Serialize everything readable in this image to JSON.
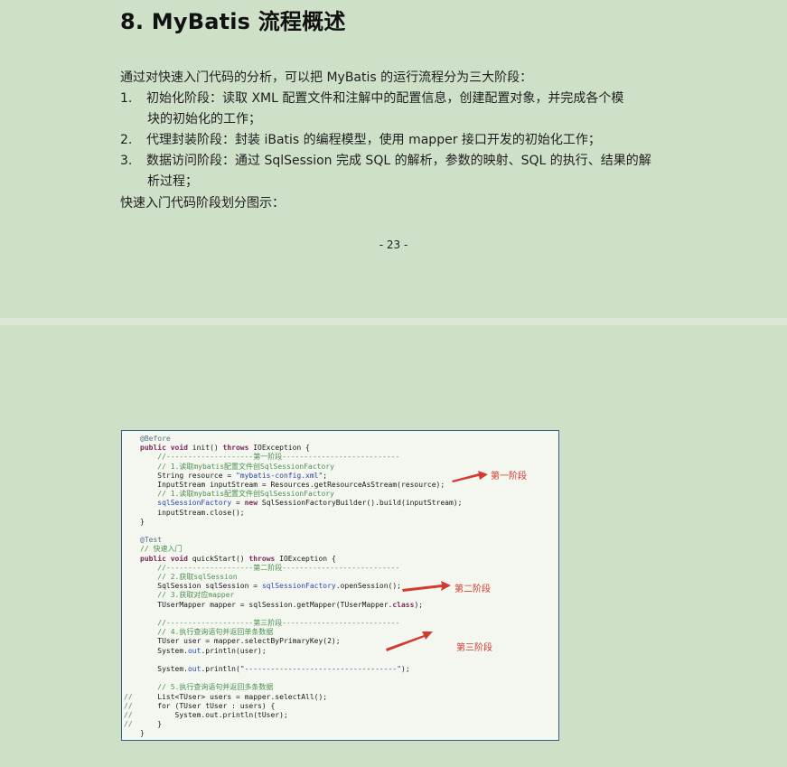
{
  "heading": "8. MyBatis 流程概述",
  "intro": "通过对快速入门代码的分析，可以把 MyBatis 的运行流程分为三大阶段：",
  "stages": [
    {
      "num": "1.",
      "text": "初始化阶段：读取 XML 配置文件和注解中的配置信息，创建配置对象，并完成各个模",
      "cont": "块的初始化的工作；"
    },
    {
      "num": "2.",
      "text": "代理封装阶段：封装 iBatis 的编程模型，使用 mapper 接口开发的初始化工作；",
      "cont": ""
    },
    {
      "num": "3.",
      "text": "数据访问阶段：通过 SqlSession 完成 SQL 的解析，参数的映射、SQL 的执行、结果的解",
      "cont": "析过程；"
    }
  ],
  "outro": "快速入门代码阶段划分图示：",
  "page_number": "- 23 -",
  "code_figure": {
    "annotations": [
      "第一阶段",
      "第二阶段",
      "第三阶段"
    ],
    "lines": [
      {
        "gutter": "",
        "segments": [
          {
            "cls": "c-ann",
            "text": "@Before"
          }
        ]
      },
      {
        "gutter": "",
        "segments": [
          {
            "cls": "c-kw",
            "text": "public void "
          },
          {
            "cls": "",
            "text": "init() "
          },
          {
            "cls": "c-kw",
            "text": "throws "
          },
          {
            "cls": "",
            "text": "IOException {"
          }
        ]
      },
      {
        "gutter": "",
        "segments": [
          {
            "cls": "c-cm",
            "text": "    //--------------------第一阶段---------------------------"
          }
        ]
      },
      {
        "gutter": "",
        "segments": [
          {
            "cls": "c-cm",
            "text": "    // 1.读取mybatis配置文件创SqlSessionFactory"
          }
        ]
      },
      {
        "gutter": "",
        "segments": [
          {
            "cls": "",
            "text": "    String resource = "
          },
          {
            "cls": "c-st",
            "text": "\"mybatis-config.xml\""
          },
          {
            "cls": "",
            "text": ";"
          }
        ]
      },
      {
        "gutter": "",
        "segments": [
          {
            "cls": "",
            "text": "    InputStream inputStream = Resources.getResourceAsStream(resource);"
          }
        ]
      },
      {
        "gutter": "",
        "segments": [
          {
            "cls": "c-cm",
            "text": "    // 1.读取mybatis配置文件创SqlSessionFactory"
          }
        ]
      },
      {
        "gutter": "",
        "segments": [
          {
            "cls": "c-fd",
            "text": "    sqlSessionFactory"
          },
          {
            "cls": "",
            "text": " = "
          },
          {
            "cls": "c-kw",
            "text": "new "
          },
          {
            "cls": "",
            "text": "SqlSessionFactoryBuilder().build(inputStream);"
          }
        ]
      },
      {
        "gutter": "",
        "segments": [
          {
            "cls": "",
            "text": "    inputStream.close();"
          }
        ]
      },
      {
        "gutter": "",
        "segments": [
          {
            "cls": "",
            "text": "}"
          }
        ]
      },
      {
        "gutter": "",
        "segments": [
          {
            "cls": "",
            "text": ""
          }
        ]
      },
      {
        "gutter": "",
        "segments": [
          {
            "cls": "c-ann",
            "text": "@Test"
          }
        ]
      },
      {
        "gutter": "",
        "segments": [
          {
            "cls": "c-cm",
            "text": "// 快速入门"
          }
        ]
      },
      {
        "gutter": "",
        "segments": [
          {
            "cls": "c-kw",
            "text": "public void "
          },
          {
            "cls": "",
            "text": "quickStart() "
          },
          {
            "cls": "c-kw",
            "text": "throws "
          },
          {
            "cls": "",
            "text": "IOException {"
          }
        ]
      },
      {
        "gutter": "",
        "segments": [
          {
            "cls": "c-cm",
            "text": "    //--------------------第二阶段---------------------------"
          }
        ]
      },
      {
        "gutter": "",
        "segments": [
          {
            "cls": "c-cm",
            "text": "    // 2.获取sqlSession"
          }
        ]
      },
      {
        "gutter": "",
        "segments": [
          {
            "cls": "",
            "text": "    SqlSession sqlSession = "
          },
          {
            "cls": "c-fd",
            "text": "sqlSessionFactory"
          },
          {
            "cls": "",
            "text": ".openSession();"
          }
        ]
      },
      {
        "gutter": "",
        "segments": [
          {
            "cls": "c-cm",
            "text": "    // 3.获取对应mapper"
          }
        ]
      },
      {
        "gutter": "",
        "segments": [
          {
            "cls": "",
            "text": "    TUserMapper mapper = sqlSession.getMapper(TUserMapper."
          },
          {
            "cls": "c-kw",
            "text": "class"
          },
          {
            "cls": "",
            "text": ");"
          }
        ]
      },
      {
        "gutter": "",
        "segments": [
          {
            "cls": "",
            "text": ""
          }
        ]
      },
      {
        "gutter": "",
        "segments": [
          {
            "cls": "c-cm",
            "text": "    //--------------------第三阶段---------------------------"
          }
        ]
      },
      {
        "gutter": "",
        "segments": [
          {
            "cls": "c-cm",
            "text": "    // 4.执行查询语句并返回单条数据"
          }
        ]
      },
      {
        "gutter": "",
        "segments": [
          {
            "cls": "",
            "text": "    TUser user = mapper.selectByPrimaryKey(2);"
          }
        ]
      },
      {
        "gutter": "",
        "segments": [
          {
            "cls": "",
            "text": "    System."
          },
          {
            "cls": "c-fd",
            "text": "out"
          },
          {
            "cls": "",
            "text": ".println(user);"
          }
        ]
      },
      {
        "gutter": "",
        "segments": [
          {
            "cls": "",
            "text": ""
          }
        ]
      },
      {
        "gutter": "",
        "segments": [
          {
            "cls": "",
            "text": "    System."
          },
          {
            "cls": "c-fd",
            "text": "out"
          },
          {
            "cls": "",
            "text": ".println("
          },
          {
            "cls": "c-st",
            "text": "\"-----------------------------------\""
          },
          {
            "cls": "",
            "text": ");"
          }
        ]
      },
      {
        "gutter": "",
        "segments": [
          {
            "cls": "",
            "text": ""
          }
        ]
      },
      {
        "gutter": "",
        "segments": [
          {
            "cls": "c-cm",
            "text": "    // 5.执行查询语句并返回多条数据"
          }
        ]
      },
      {
        "gutter": "//",
        "segments": [
          {
            "cls": "",
            "text": "    List<TUser> users = mapper.selectAll();"
          }
        ]
      },
      {
        "gutter": "//",
        "segments": [
          {
            "cls": "",
            "text": "    for (TUser tUser : users) {"
          }
        ]
      },
      {
        "gutter": "//",
        "segments": [
          {
            "cls": "",
            "text": "        System.out.println(tUser);"
          }
        ]
      },
      {
        "gutter": "//",
        "segments": [
          {
            "cls": "",
            "text": "    }"
          }
        ]
      },
      {
        "gutter": "",
        "segments": [
          {
            "cls": "",
            "text": "}"
          }
        ]
      }
    ]
  }
}
